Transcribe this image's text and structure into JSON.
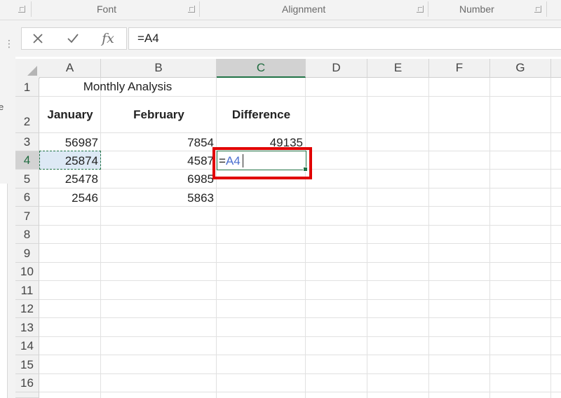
{
  "ribbon": {
    "groups": [
      {
        "label": "Font"
      },
      {
        "label": "Alignment"
      },
      {
        "label": "Number"
      }
    ]
  },
  "formula_bar": {
    "cancel_icon": "x-icon",
    "enter_icon": "checkmark-icon",
    "function_icon": "fx-icon",
    "fx_label": "fx",
    "formula": "=A4"
  },
  "left_pane": {
    "letter": "e"
  },
  "columns": [
    "A",
    "B",
    "C",
    "D",
    "E",
    "F",
    "G"
  ],
  "selected_column": "C",
  "rows": [
    "1",
    "2",
    "3",
    "4",
    "5",
    "6",
    "7",
    "8",
    "9",
    "10",
    "11",
    "12",
    "13",
    "14",
    "15",
    "16"
  ],
  "selected_row": "4",
  "sheet": {
    "title": "Monthly Analysis",
    "headers": {
      "a": "January",
      "b": "February",
      "c": "Difference"
    },
    "data": [
      {
        "a": "56987",
        "b": "7854",
        "c": "49135"
      },
      {
        "a": "25874",
        "b": "4587",
        "c": ""
      },
      {
        "a": "25478",
        "b": "6985",
        "c": ""
      },
      {
        "a": "2546",
        "b": "5863",
        "c": ""
      }
    ]
  },
  "editing_cell": {
    "prefix": "=",
    "reference": "A4"
  },
  "colors": {
    "accent": "#217346",
    "highlight": "#e10000",
    "reference": "#4a6fd0"
  }
}
